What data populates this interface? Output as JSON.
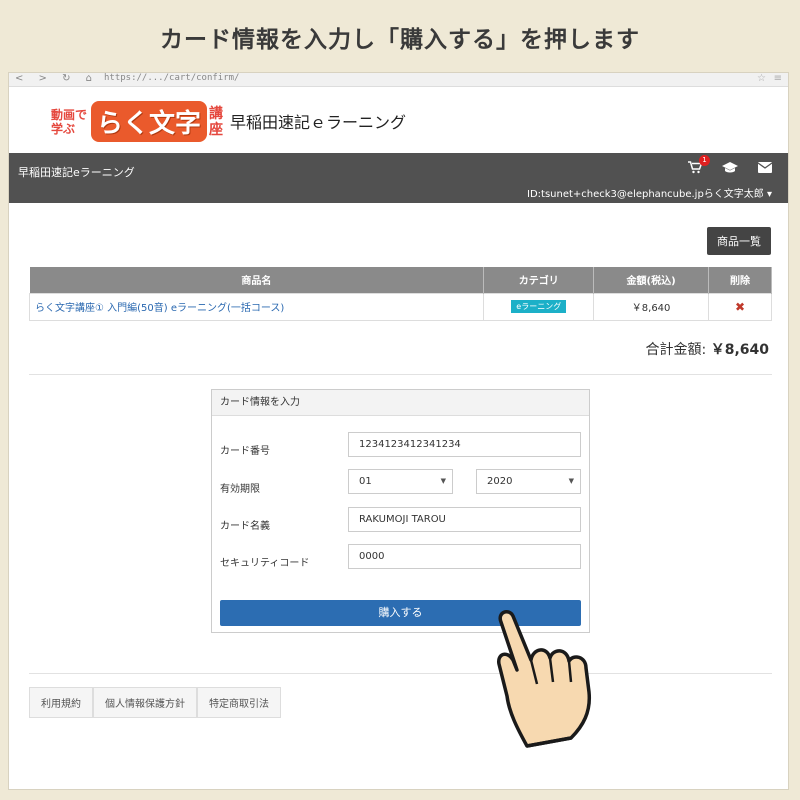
{
  "caption": "カード情報を入力し「購入する」を押します",
  "browser": {
    "url_text": "https://.../cart/confirm/",
    "nav_glyphs": "< > ↻ ⌂",
    "star_glyph": "☆",
    "menu_glyph": "≡"
  },
  "logo": {
    "small_text": "動画で学ぶ",
    "main_text": "らく文字",
    "suffix_text": "講座",
    "site_name": "早稲田速記ｅラーニング"
  },
  "navbar": {
    "brand": "早稲田速記eラーニング",
    "cart_count": "1",
    "user_id": "ID:tsunet+check3@elephancube.jpらく文字太郎 ▾"
  },
  "content": {
    "list_button": "商品一覧",
    "table": {
      "headers": [
        "商品名",
        "カテゴリ",
        "金額(税込)",
        "削除"
      ],
      "rows": [
        {
          "name": "らく文字講座① 入門編(50音) eラーニング(一括コース)",
          "category": "eラーニング",
          "price": "￥8,640",
          "delete": "✖"
        }
      ]
    },
    "total_label": "合計金額:",
    "total_value": "￥8,640"
  },
  "card_form": {
    "title": "カード情報を入力",
    "card_number_label": "カード番号",
    "card_number_value": "1234123412341234",
    "expiry_label": "有効期限",
    "expiry_month": "01",
    "expiry_year": "2020",
    "holder_label": "カード名義",
    "holder_value": "RAKUMOJI TAROU",
    "cvc_label": "セキュリティコード",
    "cvc_value": "0000",
    "submit": "購入する"
  },
  "footer": {
    "links": [
      "利用規約",
      "個人情報保護方針",
      "特定商取引法"
    ]
  },
  "colors": {
    "accent": "#2c6db2",
    "navbar": "#515151",
    "category": "#1cb0c8"
  },
  "icons": {
    "cart": "cart-icon",
    "graduation": "graduation-cap-icon",
    "mail": "mail-icon",
    "pointer": "pointing-hand-icon"
  }
}
